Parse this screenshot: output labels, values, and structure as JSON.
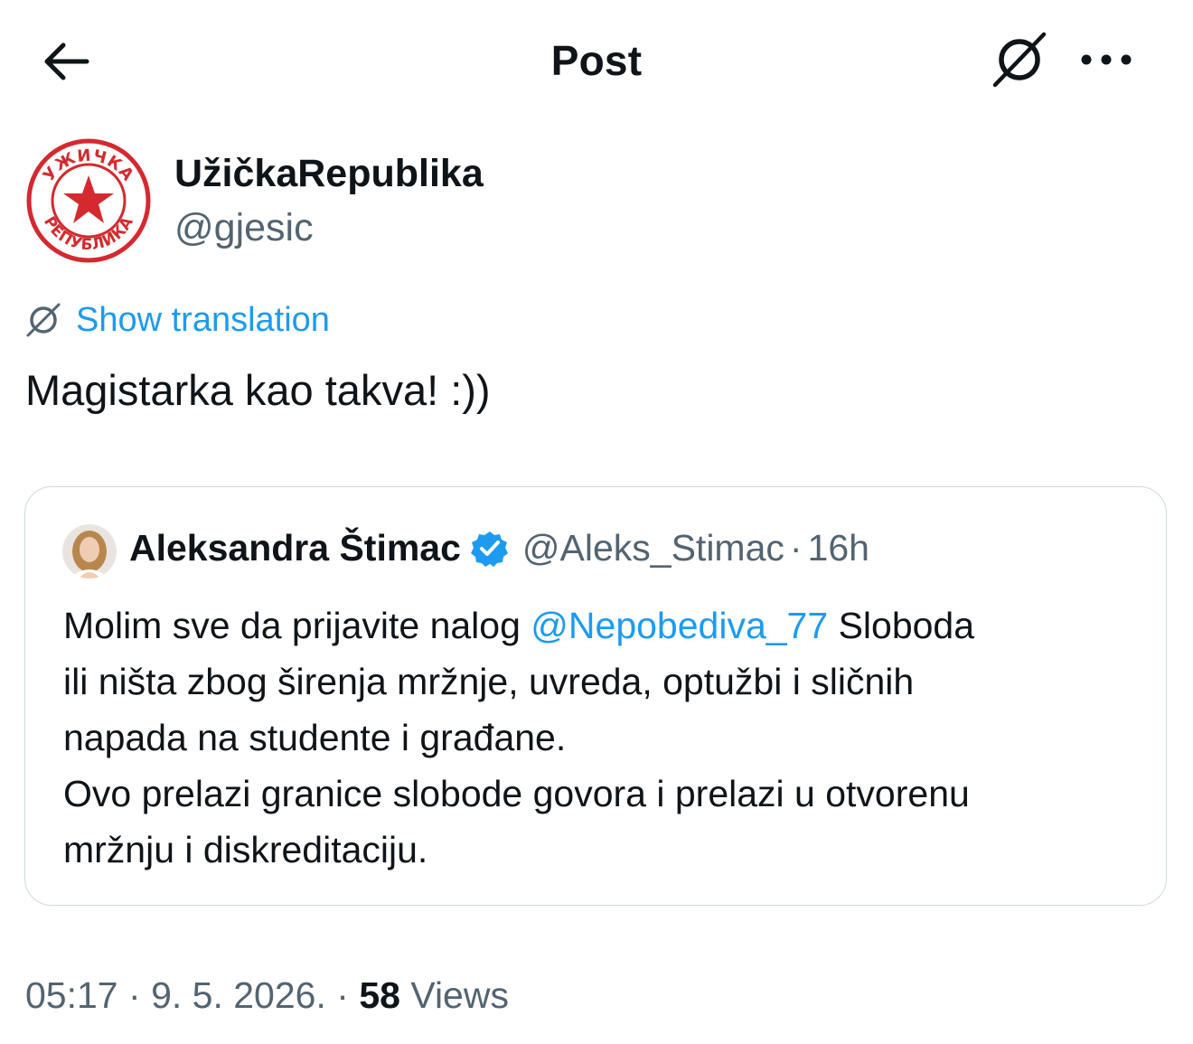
{
  "header": {
    "title": "Post",
    "back_icon": "arrow-left-icon",
    "translate_icon": "translate-slash-icon",
    "more_icon": "more-horizontal-icon"
  },
  "author": {
    "name": "UžičkaRepublika",
    "handle": "@gjesic",
    "avatar_top_text": "УЖИЧКА",
    "avatar_bottom_text": "РЕПУБЛИКА",
    "avatar_color": "#d42a2f"
  },
  "translation": {
    "label": "Show translation",
    "icon": "translate-slash-icon"
  },
  "post": {
    "text": "Magistarka kao takva! :))"
  },
  "quote": {
    "name": "Aleksandra Štimac",
    "verified_icon": "verified-badge-icon",
    "handle": "@Aleks_Stimac",
    "separator": "·",
    "time": "16h",
    "body": {
      "line1_before": "Molim sve da prijavite nalog ",
      "mention": "@Nepobediva_77",
      "line1_after": " Sloboda",
      "line2": "ili ništa zbog širenja mržnje, uvreda, optužbi i sličnih",
      "line3": "napada na studente i građane.",
      "line4": "Ovo prelazi granice slobode govora i prelazi u otvorenu",
      "line5": "mržnju i diskreditaciju."
    }
  },
  "meta": {
    "time": "05:17",
    "separator1": "·",
    "date": "9. 5. 2026.",
    "separator2": "·",
    "views_count": "58",
    "views_label": "Views"
  },
  "colors": {
    "text": "#0f1419",
    "secondary": "#536471",
    "link": "#1d9bf0",
    "border": "#cfd9de",
    "verified": "#1d9bf0"
  }
}
